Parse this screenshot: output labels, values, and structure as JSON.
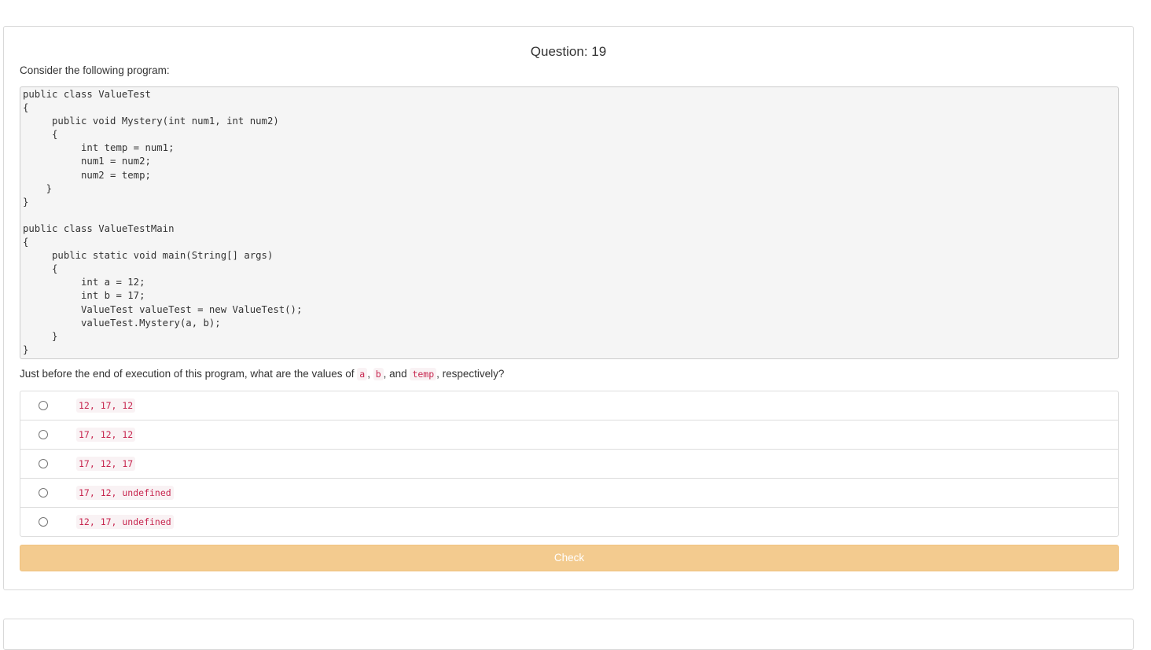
{
  "question": {
    "title": "Question: 19",
    "prompt": "Consider the following program:",
    "code": "public class ValueTest\n{\n     public void Mystery(int num1, int num2)\n     {\n          int temp = num1;\n          num1 = num2;\n          num2 = temp;\n    }\n}\n\npublic class ValueTestMain\n{\n     public static void main(String[] args)\n     {\n          int a = 12;\n          int b = 17;\n          ValueTest valueTest = new ValueTest();\n          valueTest.Mystery(a, b);\n     }\n}",
    "text_before": "Just before the end of execution of this program, what are the values of ",
    "var_a": "a",
    "sep1": ", ",
    "var_b": "b",
    "sep2": ", and ",
    "var_temp": "temp",
    "text_after": ", respectively?"
  },
  "options": [
    {
      "label": "12, 17, 12"
    },
    {
      "label": "17, 12, 12"
    },
    {
      "label": "17, 12, 17"
    },
    {
      "label": "17, 12, undefined"
    },
    {
      "label": "12, 17, undefined"
    }
  ],
  "check_button": {
    "label": "Check"
  },
  "colors": {
    "check_button_bg": "#f3cb8f",
    "inline_code_text": "#c7254e",
    "inline_code_bg": "#f9f2f4",
    "code_block_bg": "#f5f5f5"
  }
}
